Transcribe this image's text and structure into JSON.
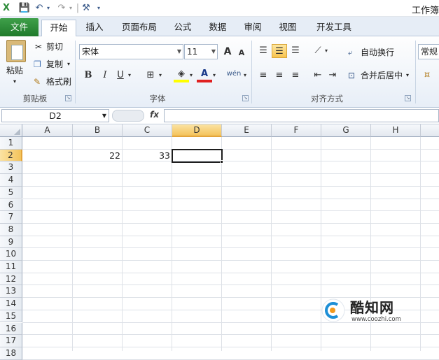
{
  "window": {
    "title": "工作簿"
  },
  "qat": {
    "save": "💾",
    "undo": "↶",
    "redo": "↷",
    "tools": "⚒",
    "customize": "▾",
    "sep": "|"
  },
  "tabs": [
    "文件",
    "开始",
    "插入",
    "页面布局",
    "公式",
    "数据",
    "审阅",
    "视图",
    "开发工具"
  ],
  "clipboard": {
    "paste": "粘贴",
    "cut": "剪切",
    "copy": "复制",
    "format_painter": "格式刷",
    "label": "剪贴板"
  },
  "font": {
    "name": "宋体",
    "size": "11",
    "bold": "B",
    "italic": "I",
    "underline": "U",
    "grow": "A",
    "shrink": "A",
    "font_color": "A",
    "phonetic": "wén",
    "label": "字体"
  },
  "alignment": {
    "wrap": "自动换行",
    "merge": "合并后居中",
    "label": "对齐方式"
  },
  "number": {
    "format": "常规"
  },
  "formula_bar": {
    "name_box": "D2",
    "fx": "fx",
    "value": ""
  },
  "columns": [
    "A",
    "B",
    "C",
    "D",
    "E",
    "F",
    "G",
    "H"
  ],
  "rows": [
    "1",
    "2",
    "3",
    "4",
    "5",
    "6",
    "7",
    "8",
    "9",
    "10",
    "11",
    "12",
    "13",
    "14",
    "15",
    "16",
    "17",
    "18"
  ],
  "cells": {
    "B2": "22",
    "C2": "33"
  },
  "active_cell": "D2",
  "watermark": {
    "brand": "酷知网",
    "url": "www.coozhi.com"
  },
  "colors": {
    "file_tab": "#2a8a36",
    "selection": "#f4c35b",
    "ribbon_bg": "#e7eef7"
  }
}
